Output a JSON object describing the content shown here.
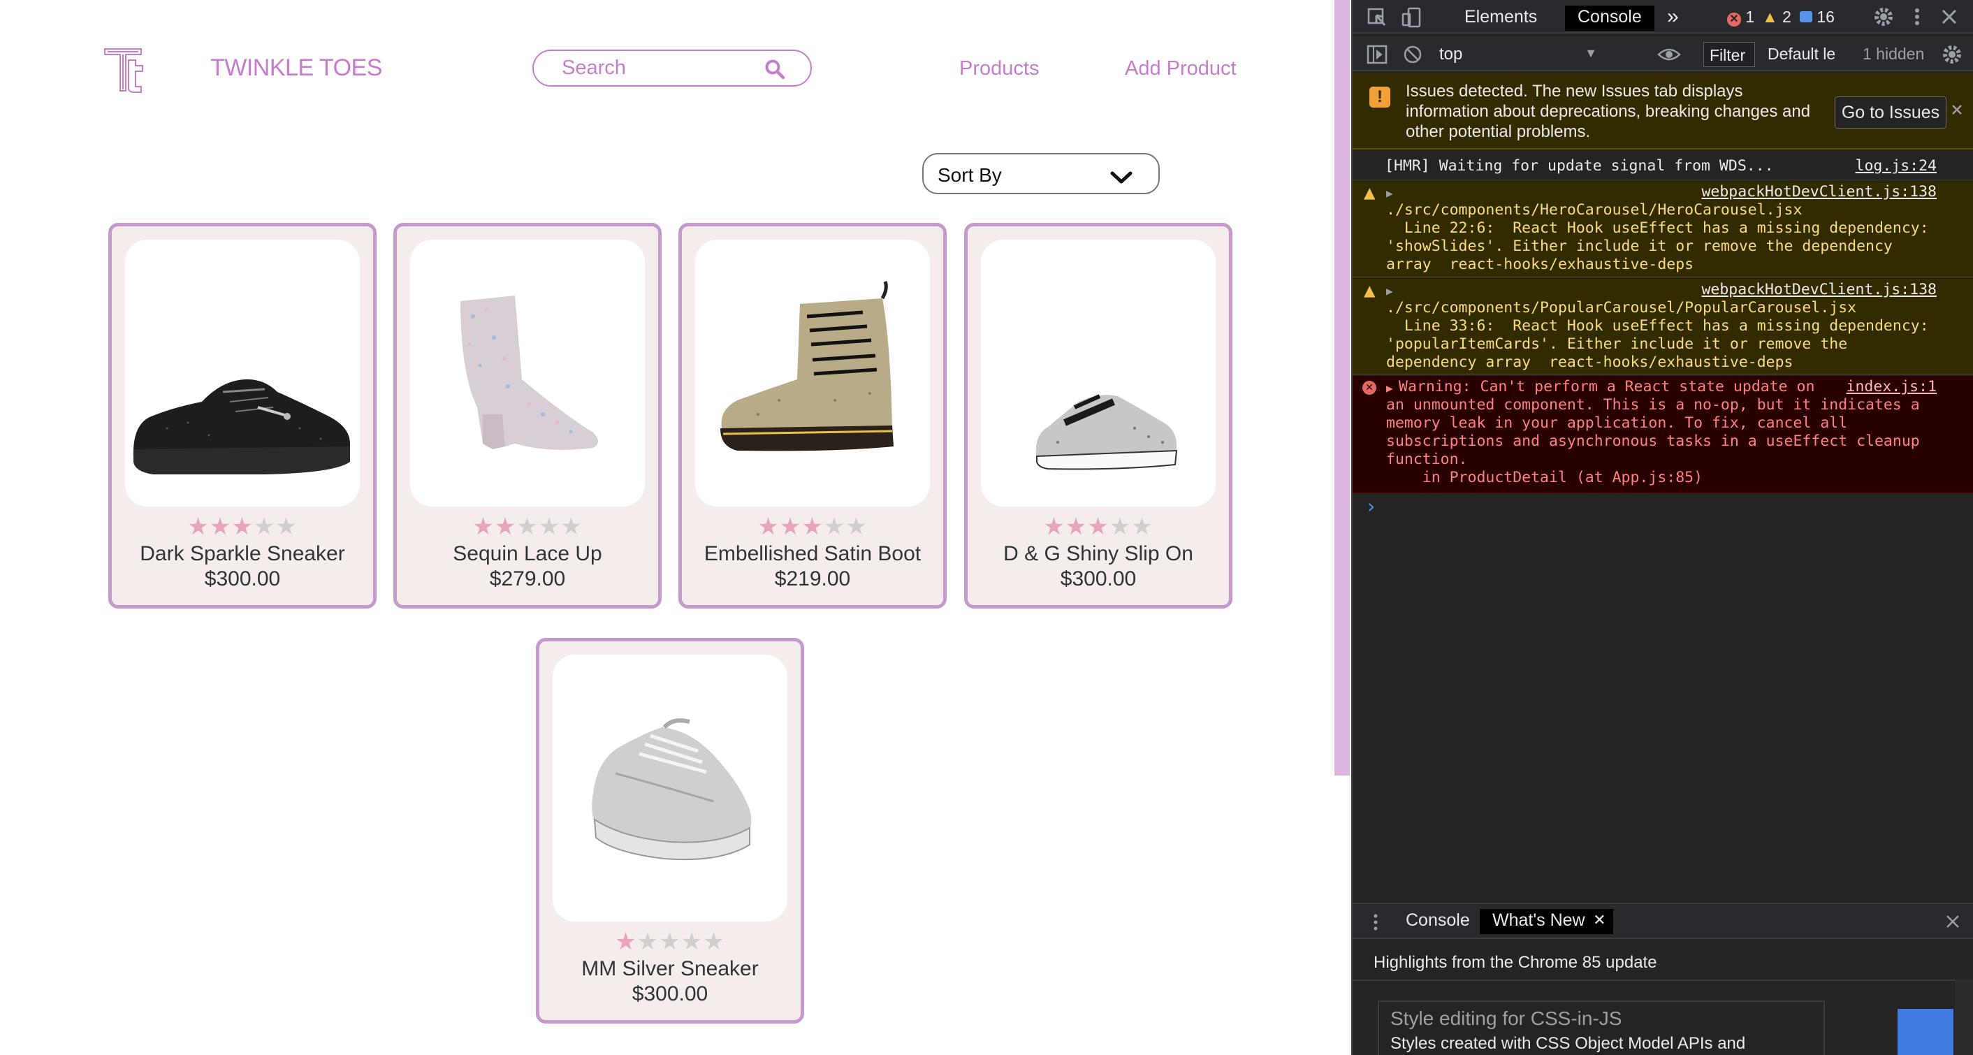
{
  "app": {
    "brand": "TWINKLE TOES",
    "search": {
      "placeholder": "Search"
    },
    "nav": [
      {
        "label": "Products"
      },
      {
        "label": "Add Product"
      }
    ],
    "sort": {
      "label": "Sort By"
    },
    "products": [
      {
        "name": "Dark Sparkle Sneaker",
        "price": "$300.00",
        "rating": 3,
        "max_rating": 5
      },
      {
        "name": "Sequin Lace Up",
        "price": "$279.00",
        "rating": 2,
        "max_rating": 5
      },
      {
        "name": "Embellished Satin Boot",
        "price": "$219.00",
        "rating": 3,
        "max_rating": 5
      },
      {
        "name": "D & G Shiny Slip On",
        "price": "$300.00",
        "rating": 3,
        "max_rating": 5
      },
      {
        "name": "MM Silver Sneaker",
        "price": "$300.00",
        "rating": 1,
        "max_rating": 5
      }
    ],
    "colors": {
      "accent": "#c77dcd",
      "card_border": "#c39acb",
      "card_bg": "#f5ecec",
      "star_on": "#e8a4ba",
      "star_off": "#cfcfd2"
    }
  },
  "devtools": {
    "tabs": {
      "elements": "Elements",
      "console": "Console",
      "more": "»"
    },
    "counts": {
      "errors": "1",
      "warnings": "2",
      "messages": "16"
    },
    "toolbar": {
      "context": "top",
      "filter": "Filter",
      "levels": "Default le",
      "hidden": "1 hidden"
    },
    "issues": {
      "text": "Issues detected. The new Issues tab displays information about deprecations, breaking changes and other potential problems.",
      "button": "Go to Issues"
    },
    "messages": [
      {
        "type": "log",
        "text": "[HMR] Waiting for update signal from WDS...",
        "source": "log.js:24"
      },
      {
        "type": "warn",
        "source": "webpackHotDevClient.js:138",
        "lines": [
          "./src/components/HeroCarousel/HeroCarousel.jsx",
          "  Line 22:6:  React Hook useEffect has a missing dependency:",
          "'showSlides'. Either include it or remove the dependency",
          "array  react-hooks/exhaustive-deps"
        ]
      },
      {
        "type": "warn",
        "source": "webpackHotDevClient.js:138",
        "lines": [
          "./src/components/PopularCarousel/PopularCarousel.jsx",
          "  Line 33:6:  React Hook useEffect has a missing dependency:",
          "'popularItemCards'. Either include it or remove the",
          "dependency array  react-hooks/exhaustive-deps"
        ]
      },
      {
        "type": "error",
        "source": "index.js:1",
        "lines": [
          "Warning: Can't perform a React state update on",
          "an unmounted component. This is a no-op, but it indicates a",
          "memory leak in your application. To fix, cancel all",
          "subscriptions and asynchronous tasks in a useEffect cleanup",
          "function.",
          "    in ProductDetail (at App.js:85)"
        ]
      }
    ],
    "prompt": "›",
    "drawer": {
      "tabs": {
        "console": "Console",
        "whats_new": "What's New"
      },
      "highlights": "Highlights from the Chrome 85 update",
      "feature_title": "Style editing for CSS-in-JS",
      "feature_desc": "Styles created with CSS Object Model APIs and"
    }
  }
}
